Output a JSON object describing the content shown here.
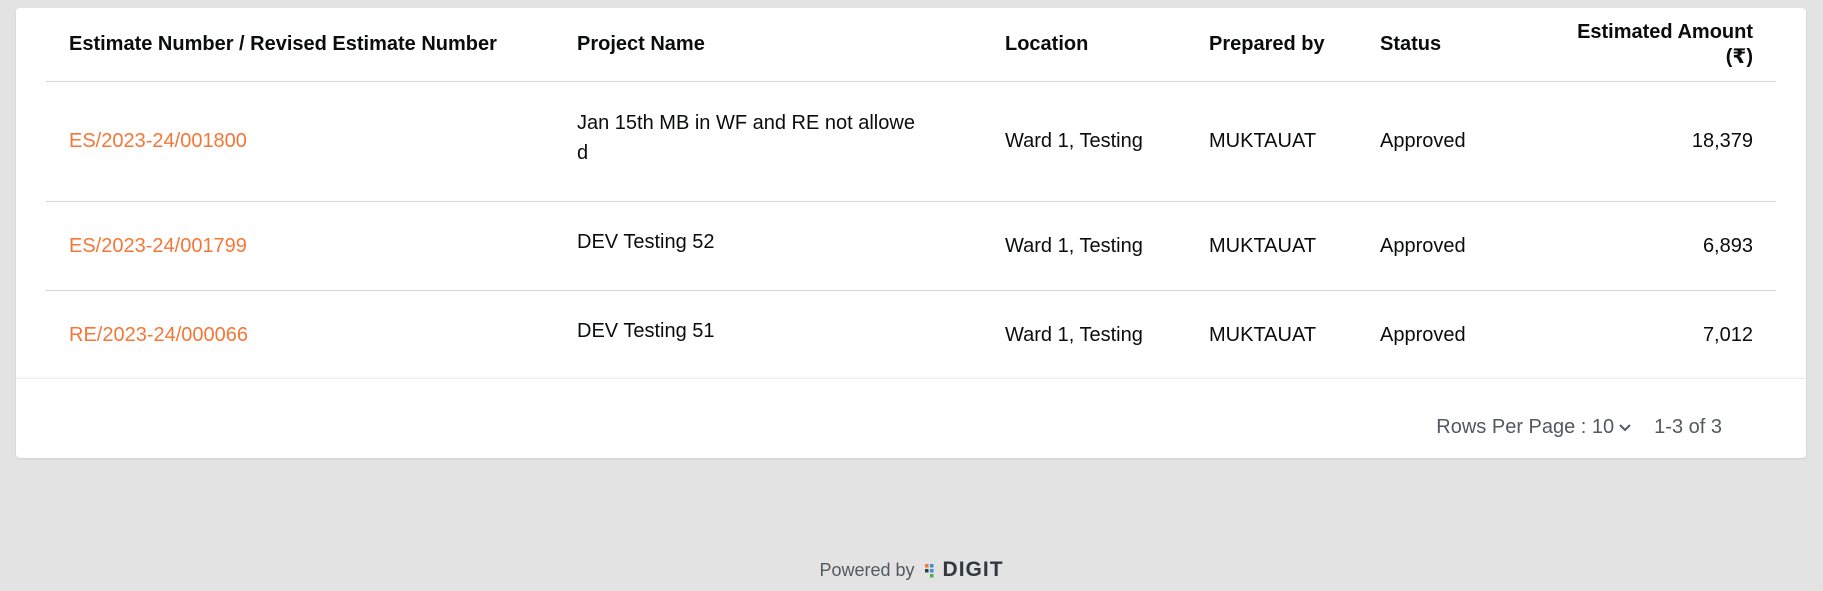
{
  "table": {
    "headers": {
      "estimate_number": "Estimate Number / Revised Estimate Number",
      "project_name": "Project Name",
      "location": "Location",
      "prepared_by": "Prepared by",
      "status": "Status",
      "amount": "Estimated Amount (₹)"
    },
    "rows": [
      {
        "estimate_number": "ES/2023-24/001800",
        "project_name": "Jan 15th MB in WF and RE not allowed",
        "location": "Ward 1, Testing",
        "prepared_by": "MUKTAUAT",
        "status": "Approved",
        "amount": "18,379"
      },
      {
        "estimate_number": "ES/2023-24/001799",
        "project_name": "DEV Testing 52",
        "location": "Ward 1, Testing",
        "prepared_by": "MUKTAUAT",
        "status": "Approved",
        "amount": "6,893"
      },
      {
        "estimate_number": "RE/2023-24/000066",
        "project_name": "DEV Testing 51",
        "location": "Ward 1, Testing",
        "prepared_by": "MUKTAUAT",
        "status": "Approved",
        "amount": "7,012"
      }
    ]
  },
  "pagination": {
    "rows_per_page_label": "Rows Per Page : 10",
    "range_label": "1-3 of 3",
    "chevron_icon": "chevron-down-icon"
  },
  "footer": {
    "powered_by": "Powered by",
    "brand": "DIGIT"
  },
  "colors": {
    "link": "#f47738",
    "background": "#e3e3e3",
    "card": "#ffffff",
    "text": "#0b0c0c",
    "muted": "#505a5f"
  }
}
